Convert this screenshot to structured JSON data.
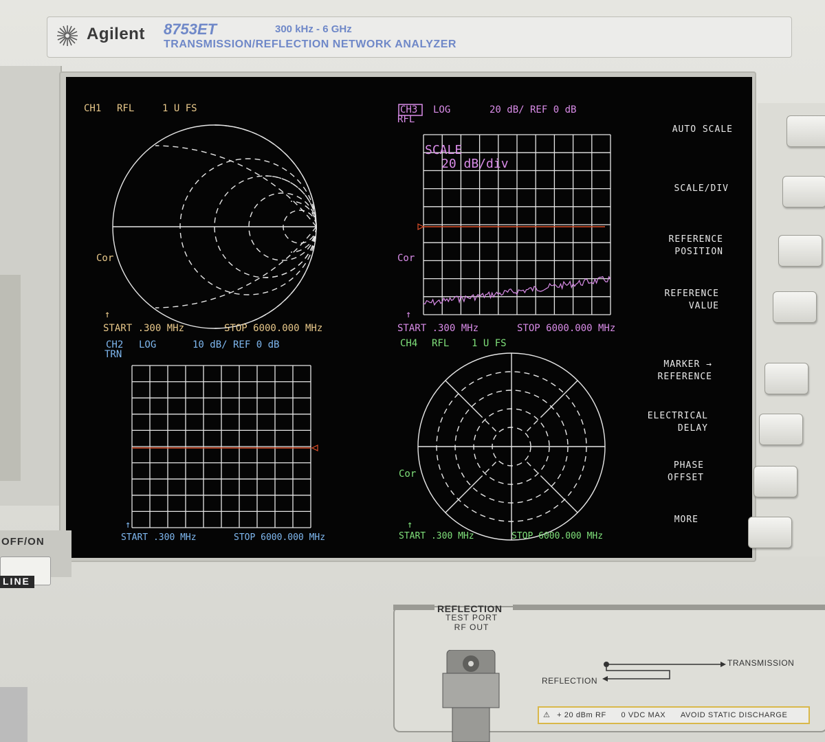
{
  "nameplate": {
    "brand": "Agilent",
    "model": "8753ET",
    "range": "300 kHz - 6 GHz",
    "description": "TRANSMISSION/REFLECTION NETWORK ANALYZER"
  },
  "colors": {
    "ch1": "#e8c88a",
    "ch2": "#7fb8f0",
    "ch3": "#d98ce8",
    "ch4": "#7fe07a",
    "grid": "#e6e6e6",
    "ref_line": "#e0502a",
    "softkey_text": "#e8e8e8"
  },
  "ch1": {
    "label": "CH1",
    "mode": "RFL",
    "scale": "1 U FS",
    "cor": "Cor",
    "arrow": "↑",
    "start": "START  .300 MHz",
    "stop": "STOP 6000.000 MHz",
    "format": "smith"
  },
  "ch3": {
    "label": "CH3",
    "format_label": "LOG",
    "scale": "20 dB/ REF 0 dB",
    "mode": "RFL",
    "scale_title": "SCALE",
    "scale_value": "20 dB/div",
    "cor": "Cor",
    "arrow": "↑",
    "start": "START  .300 MHz",
    "stop": "STOP 6000.000 MHz"
  },
  "ch2": {
    "label": "CH2",
    "format_label": "LOG",
    "scale": "10 dB/ REF 0 dB",
    "mode": "TRN",
    "arrow": "↑",
    "start": "START  .300 MHz",
    "stop": "STOP 6000.000 MHz"
  },
  "ch4": {
    "label": "CH4",
    "mode": "RFL",
    "scale": "1 U FS",
    "cor": "Cor",
    "arrow": "↑",
    "start": "START  .300 MHz",
    "stop": "STOP 6000.000 MHz",
    "format": "polar"
  },
  "softkeys": [
    "AUTO SCALE",
    "SCALE/DIV",
    "REFERENCE\nPOSITION",
    "REFERENCE\nVALUE",
    "MARKER →\nREFERENCE",
    "ELECTRICAL\nDELAY",
    "PHASE\nOFFSET",
    "MORE"
  ],
  "power": {
    "label": "OFF/ON",
    "line": "LINE"
  },
  "port": {
    "reflection": "REFLECTION",
    "test_port": "TEST PORT",
    "rf_out": "RF OUT",
    "transmission": "TRANSMISSION",
    "reflection_path": "REFLECTION",
    "warn_level": "+ 20 dBm RF",
    "warn_vdc": "0 VDC MAX",
    "warn_static": "AVOID STATIC DISCHARGE"
  }
}
